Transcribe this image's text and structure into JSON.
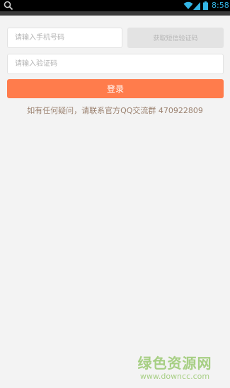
{
  "status_bar": {
    "time": "8:58",
    "icons": [
      "search-icon",
      "wifi-icon",
      "signal-icon",
      "battery-icon"
    ],
    "accent_color": "#33b5e5"
  },
  "form": {
    "phone_placeholder": "请输入手机号码",
    "phone_value": "",
    "sms_button_label": "获取短信验证码",
    "code_placeholder": "请输入验证码",
    "code_value": "",
    "login_label": "登录",
    "login_color": "#ff7c4c"
  },
  "help": {
    "text": "如有任何疑问，请联系官方QQ交流群 470922809"
  },
  "watermark": {
    "title": "绿色资源网",
    "url": "www.downcc.com"
  }
}
